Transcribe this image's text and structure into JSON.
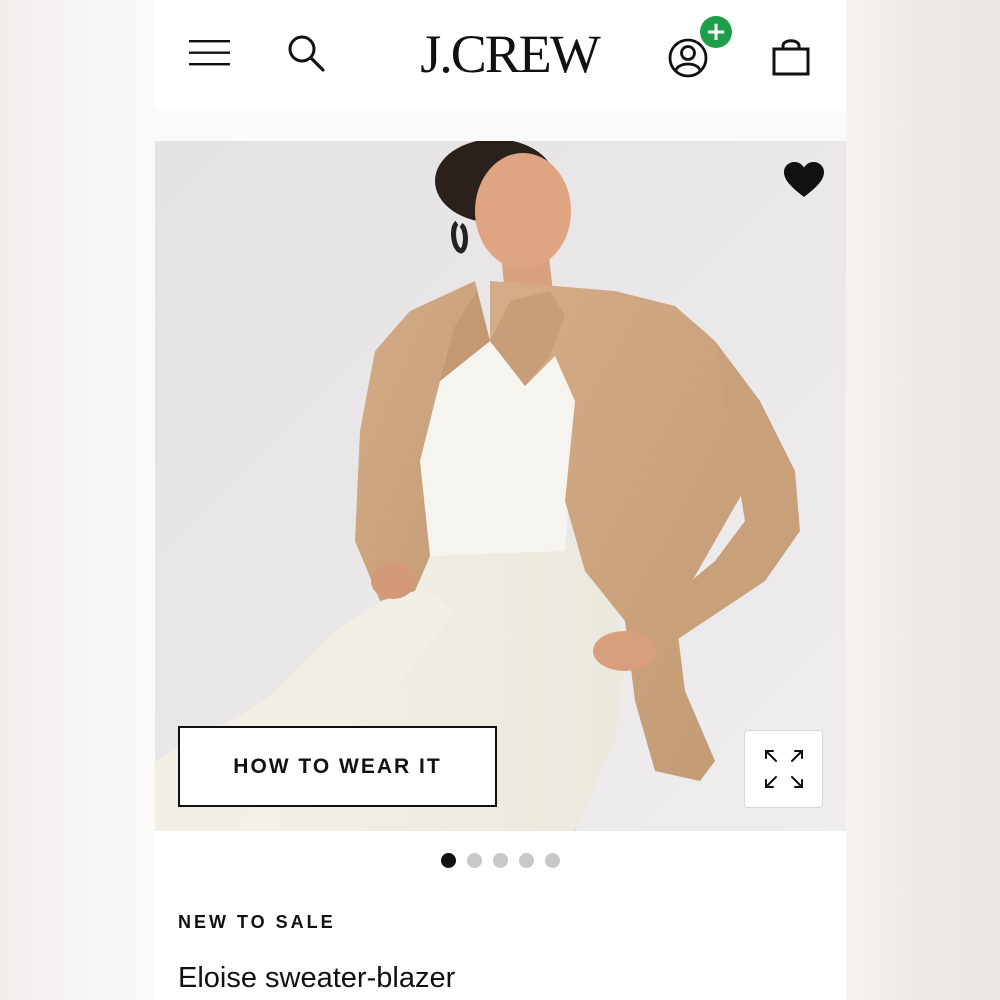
{
  "header": {
    "logo_text": "J.CREW",
    "menu_icon": "hamburger-menu-icon",
    "search_icon": "search-icon",
    "account_icon": "user-account-icon",
    "account_badge": "+",
    "account_badge_color": "#1f9e4a",
    "bag_icon": "shopping-bag-icon"
  },
  "hero": {
    "favorite_icon": "heart-icon",
    "how_to_wear_label": "HOW TO WEAR IT",
    "expand_icon": "expand-arrows-icon",
    "image_description_colors": {
      "background": "#e8e6e6",
      "blazer": "#c9a27e",
      "top_and_pants": "#f5f3ec"
    }
  },
  "carousel": {
    "total": 5,
    "active_index": 0
  },
  "product": {
    "badge": "NEW TO SALE",
    "name": "Eloise sweater-blazer"
  }
}
